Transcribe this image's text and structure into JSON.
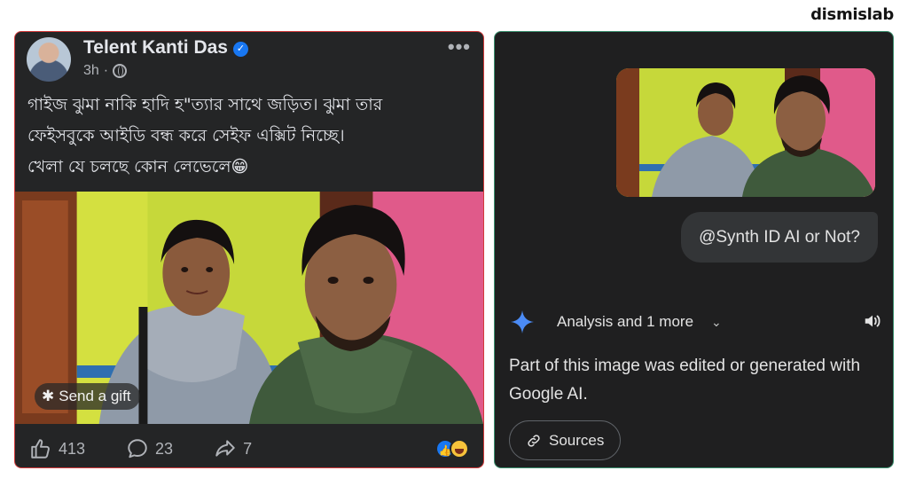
{
  "brand": "dismislab",
  "facebook_post": {
    "author": "Telent Kanti Das",
    "time": "3h",
    "caption_lines": [
      "গাইজ ঝুমা নাকি হাদি হ\"ত্যার সাথে জড়িত। ঝুমা তার",
      "ফেইসবুকে আইডি বন্ধ করে সেইফ এক্সিট নিচ্ছে।",
      "খেলা যে চলছে কোন লেভেলে😁"
    ],
    "gift_label": "Send a gift",
    "likes": "413",
    "comments": "23",
    "shares": "7"
  },
  "gemini_chat": {
    "prompt": "@Synth ID AI or Not?",
    "response_header": "Analysis and 1 more",
    "answer": "Part of this image was edited or generated with Google AI.",
    "sources_label": "Sources"
  },
  "colors": {
    "fb_card_border": "#d23a3a",
    "gemini_card_border": "#3a8f6e",
    "verified_badge": "#1877f2",
    "gemini_sparkle": "#4b8bf5"
  },
  "icons": [
    "verified-badge-icon",
    "globe-icon",
    "more-options-icon",
    "gift-icon",
    "like-icon",
    "comment-icon",
    "share-icon",
    "gemini-sparkle-icon",
    "chevron-down-icon",
    "speaker-icon",
    "link-icon"
  ]
}
